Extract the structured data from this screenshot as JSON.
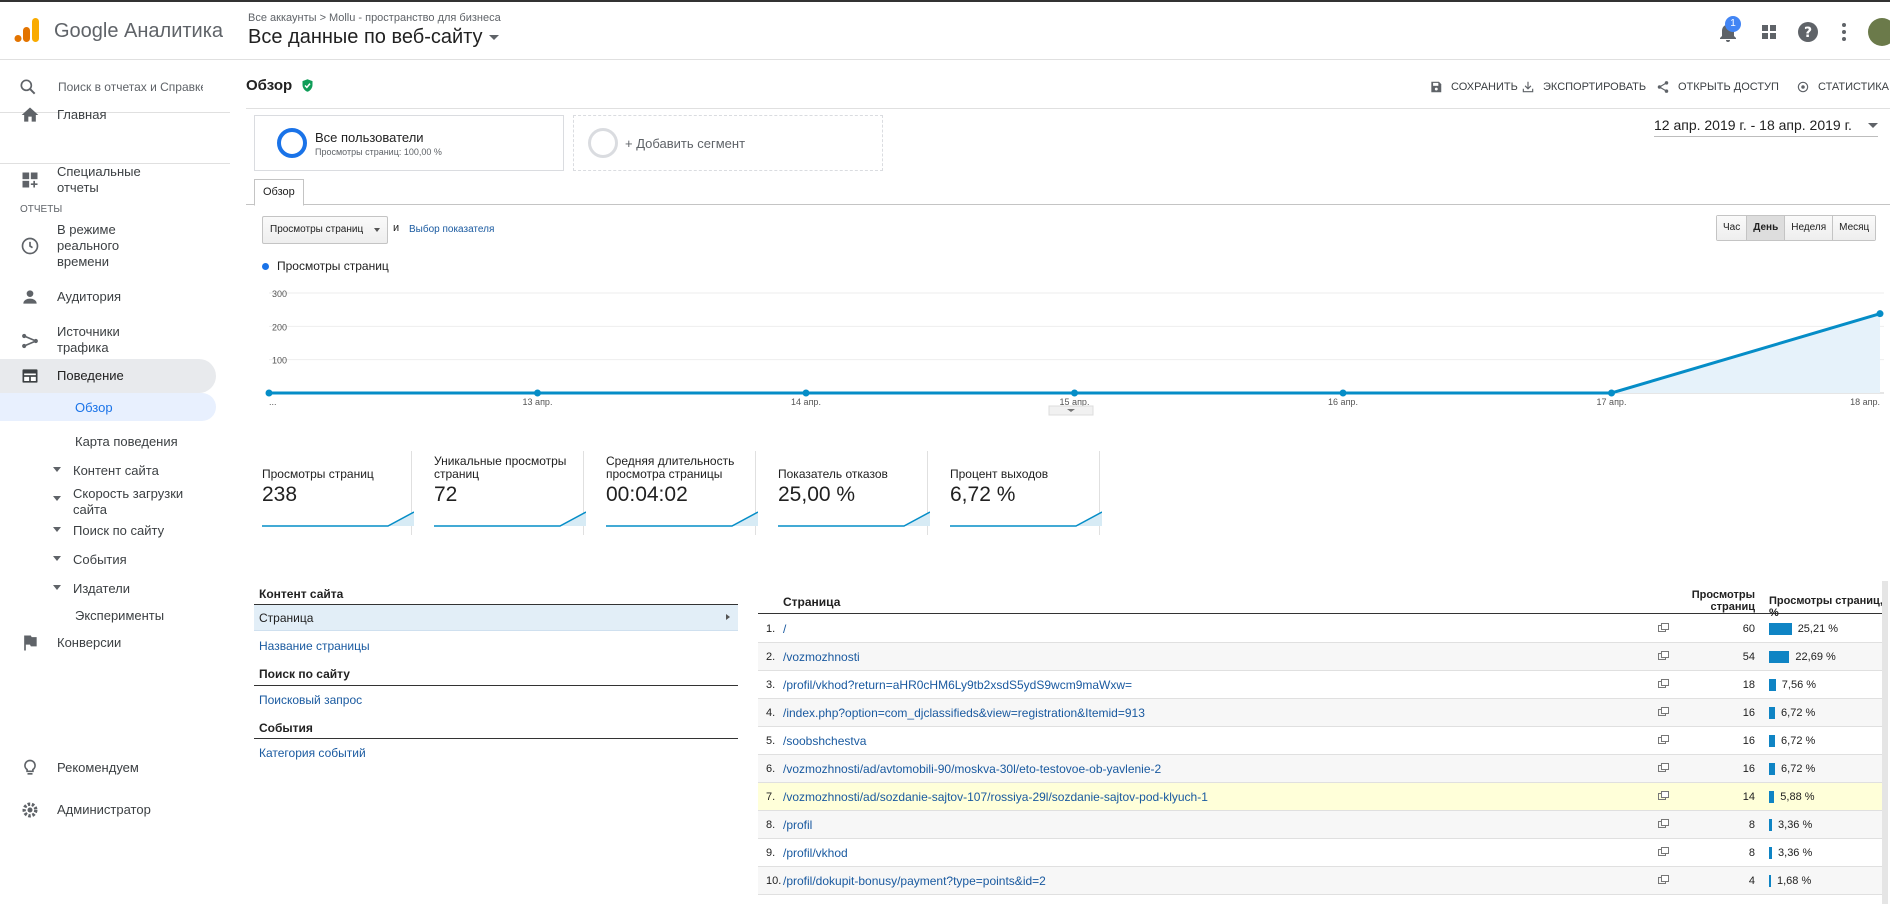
{
  "app": {
    "name": "Google Аналитика"
  },
  "header": {
    "breadcrumb": "Все аккаунты > Mollu - пространство для бизнеса",
    "view": "Все данные по веб-сайту",
    "notifications": "1"
  },
  "sidebar": {
    "search_placeholder": "Поиск в отчетах и Справке",
    "home": "Главная",
    "custom": "Специальные отчеты",
    "section": "ОТЧЕТЫ",
    "realtime": "В режиме реального времени",
    "audience": "Аудитория",
    "acquisition": "Источники трафика",
    "behavior": "Поведение",
    "overview": "Обзор",
    "behavior_flow": "Карта поведения",
    "site_content": "Контент сайта",
    "site_speed": "Скорость загрузки сайта",
    "site_search": "Поиск по сайту",
    "events": "События",
    "publisher": "Издатели",
    "experiments": "Эксперименты",
    "conversions": "Конверсии",
    "discover": "Рекомендуем",
    "admin": "Администратор"
  },
  "toolbar": {
    "title": "Обзор",
    "save": "СОХРАНИТЬ",
    "export": "ЭКСПОРТИРОВАТЬ",
    "share": "ОТКРЫТЬ ДОСТУП",
    "insights": "СТАТИСТИКА"
  },
  "segments": {
    "all_title": "Все пользователи",
    "all_sub": "Просмотры страниц: 100,00 %",
    "add": "+ Добавить сегмент"
  },
  "daterange": "12 апр. 2019 г. - 18 апр. 2019 г.",
  "tab": "Обзор",
  "metric": {
    "selected": "Просмотры страниц",
    "and": "и",
    "choose": "Выбор показателя"
  },
  "range_buttons": [
    "Час",
    "День",
    "Неделя",
    "Месяц"
  ],
  "chart_data": {
    "type": "area",
    "series": [
      {
        "name": "Просмотры страниц",
        "values": [
          0,
          0,
          0,
          0,
          0,
          0,
          238
        ]
      }
    ],
    "x": [
      "...",
      "13 апр.",
      "14 апр.",
      "15 апр.",
      "16 апр.",
      "17 апр.",
      "18 апр."
    ],
    "yticks": [
      "300",
      "200",
      "100"
    ],
    "ylim": [
      0,
      300
    ],
    "color": "#058dc7"
  },
  "scorecards": [
    {
      "label": "Просмотры страниц",
      "value": "238"
    },
    {
      "label": "Уникальные просмотры страниц",
      "value": "72"
    },
    {
      "label": "Средняя длительность просмотра страницы",
      "value": "00:04:02"
    },
    {
      "label": "Показатель отказов",
      "value": "25,00 %"
    },
    {
      "label": "Процент выходов",
      "value": "6,72 %"
    }
  ],
  "report_left": {
    "h1": "Контент сайта",
    "active": "Страница",
    "link1": "Название страницы",
    "h2": "Поиск по сайту",
    "link2": "Поисковый запрос",
    "h3": "События",
    "link3": "Категория событий"
  },
  "table": {
    "col_page": "Страница",
    "col_pv": "Просмотры страниц",
    "col_pct": "Просмотры страниц, %",
    "rows": [
      {
        "n": "1.",
        "page": "/",
        "pv": "60",
        "pct": "25,21 %",
        "share": 25.21
      },
      {
        "n": "2.",
        "page": "/vozmozhnosti",
        "pv": "54",
        "pct": "22,69 %",
        "share": 22.69
      },
      {
        "n": "3.",
        "page": "/profil/vkhod?return=aHR0cHM6Ly9tb2xsdS5ydS9wcm9maWxw=",
        "pv": "18",
        "pct": "7,56 %",
        "share": 7.56
      },
      {
        "n": "4.",
        "page": "/index.php?option=com_djclassifieds&view=registration&Itemid=913",
        "pv": "16",
        "pct": "6,72 %",
        "share": 6.72
      },
      {
        "n": "5.",
        "page": "/soobshchestva",
        "pv": "16",
        "pct": "6,72 %",
        "share": 6.72
      },
      {
        "n": "6.",
        "page": "/vozmozhnosti/ad/avtomobili-90/moskva-30l/eto-testovoe-ob-yavlenie-2",
        "pv": "16",
        "pct": "6,72 %",
        "share": 6.72
      },
      {
        "n": "7.",
        "page": "/vozmozhnosti/ad/sozdanie-sajtov-107/rossiya-29l/sozdanie-sajtov-pod-klyuch-1",
        "pv": "14",
        "pct": "5,88 %",
        "share": 5.88
      },
      {
        "n": "8.",
        "page": "/profil",
        "pv": "8",
        "pct": "3,36 %",
        "share": 3.36
      },
      {
        "n": "9.",
        "page": "/profil/vkhod",
        "pv": "8",
        "pct": "3,36 %",
        "share": 3.36
      },
      {
        "n": "10.",
        "page": "/profil/dokupit-bonusy/payment?type=points&id=2",
        "pv": "4",
        "pct": "1,68 %",
        "share": 1.68
      }
    ]
  }
}
